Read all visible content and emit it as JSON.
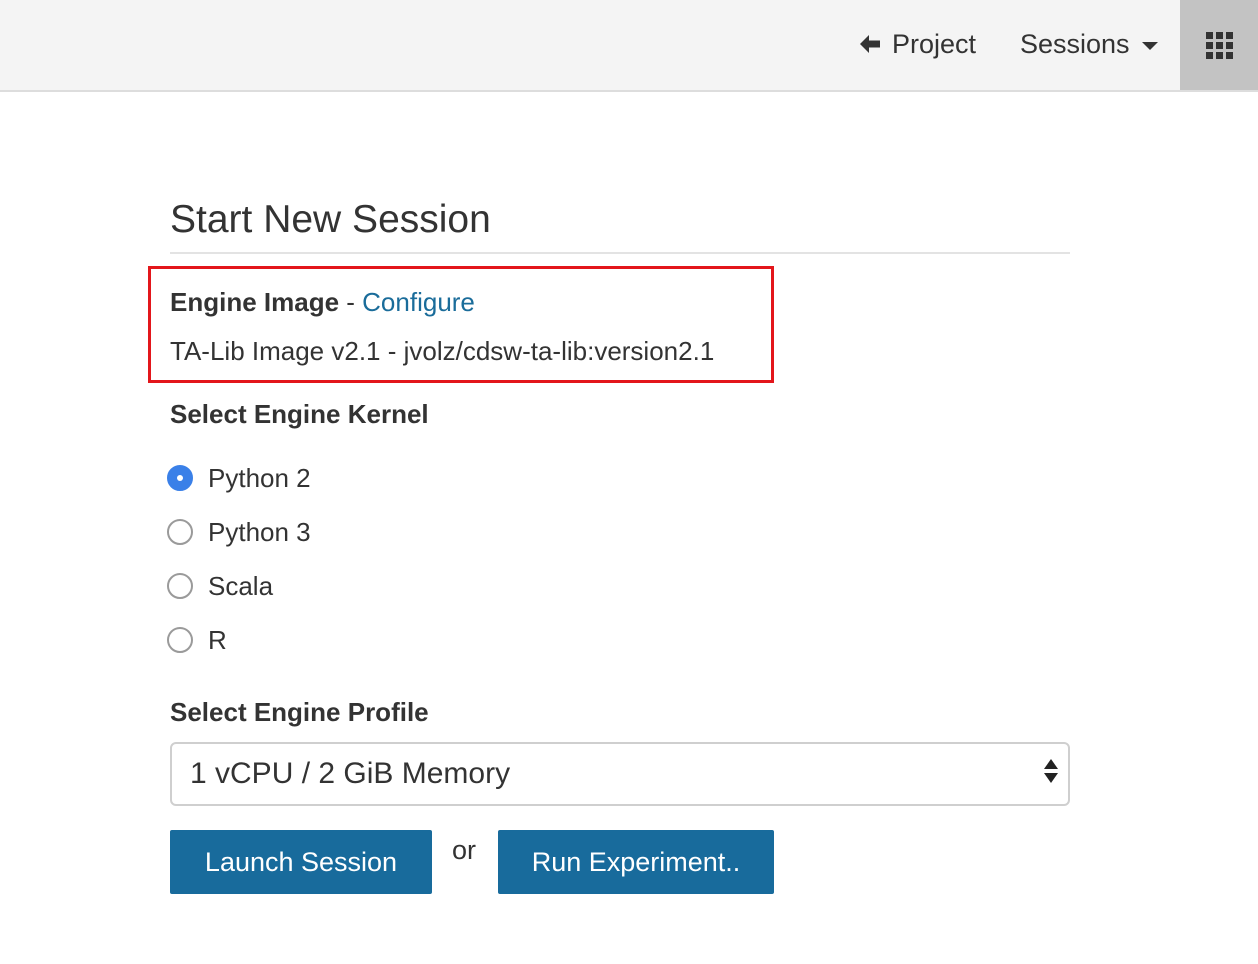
{
  "header": {
    "project_label": "Project",
    "sessions_label": "Sessions",
    "icons": {
      "back": "arrow-left-icon",
      "menu": "caret-down-icon",
      "apps": "grid-icon"
    }
  },
  "main": {
    "title": "Start New Session",
    "engine_image": {
      "label": "Engine Image",
      "separator": " - ",
      "configure_label": "Configure",
      "value": "TA-Lib Image v2.1 - jvolz/cdsw-ta-lib:version2.1"
    },
    "kernel": {
      "heading": "Select Engine Kernel",
      "options": [
        {
          "label": "Python 2",
          "checked": true
        },
        {
          "label": "Python 3",
          "checked": false
        },
        {
          "label": "Scala",
          "checked": false
        },
        {
          "label": "R",
          "checked": false
        }
      ]
    },
    "profile": {
      "heading": "Select Engine Profile",
      "selected": "1 vCPU / 2 GiB Memory"
    },
    "actions": {
      "launch_label": "Launch Session",
      "or_text": "or",
      "run_label": "Run Experiment.."
    }
  },
  "colors": {
    "primary_button": "#186b9c",
    "link": "#1a6c9a",
    "highlight_border": "#e3161b",
    "radio_checked": "#3a80e8"
  }
}
